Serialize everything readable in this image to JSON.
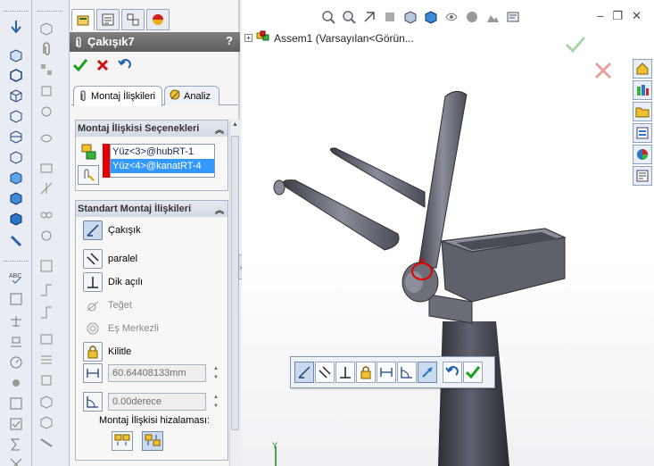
{
  "property_manager": {
    "title": "Çakışık7",
    "help": "?",
    "tabs": [
      "Montaj İlişkileri",
      "Analiz"
    ],
    "selections_group": {
      "header": "Montaj İlişkisi Seçenekleri",
      "items": [
        "Yüz<3>@hubRT-1",
        "Yüz<4>@kanatRT-4"
      ]
    },
    "standard_group": {
      "header": "Standart Montaj İlişkileri",
      "mates": [
        {
          "label": "Çakışık",
          "icon": "coincident-icon",
          "state": "on"
        },
        {
          "label": "paralel",
          "icon": "parallel-icon",
          "state": "normal"
        },
        {
          "label": "Dik açılı",
          "icon": "perpendicular-icon",
          "state": "normal"
        },
        {
          "label": "Teğet",
          "icon": "tangent-icon",
          "state": "disabled"
        },
        {
          "label": "Eş Merkezli",
          "icon": "concentric-icon",
          "state": "disabled"
        },
        {
          "label": "Kilitle",
          "icon": "lock-icon",
          "state": "normal"
        }
      ],
      "distance_value": "60.64408133mm",
      "angle_value": "0.00derece",
      "alignment_label": "Montaj İlişkisi hizalaması:"
    }
  },
  "graphics": {
    "tree_item": "Assem1  (Varsayılan<Görün..."
  },
  "colors": {
    "selection_blue": "#3399ff",
    "red_marker": "#e30000",
    "model_grey": "#5e6068",
    "title_bar": "#6e6e6e"
  }
}
